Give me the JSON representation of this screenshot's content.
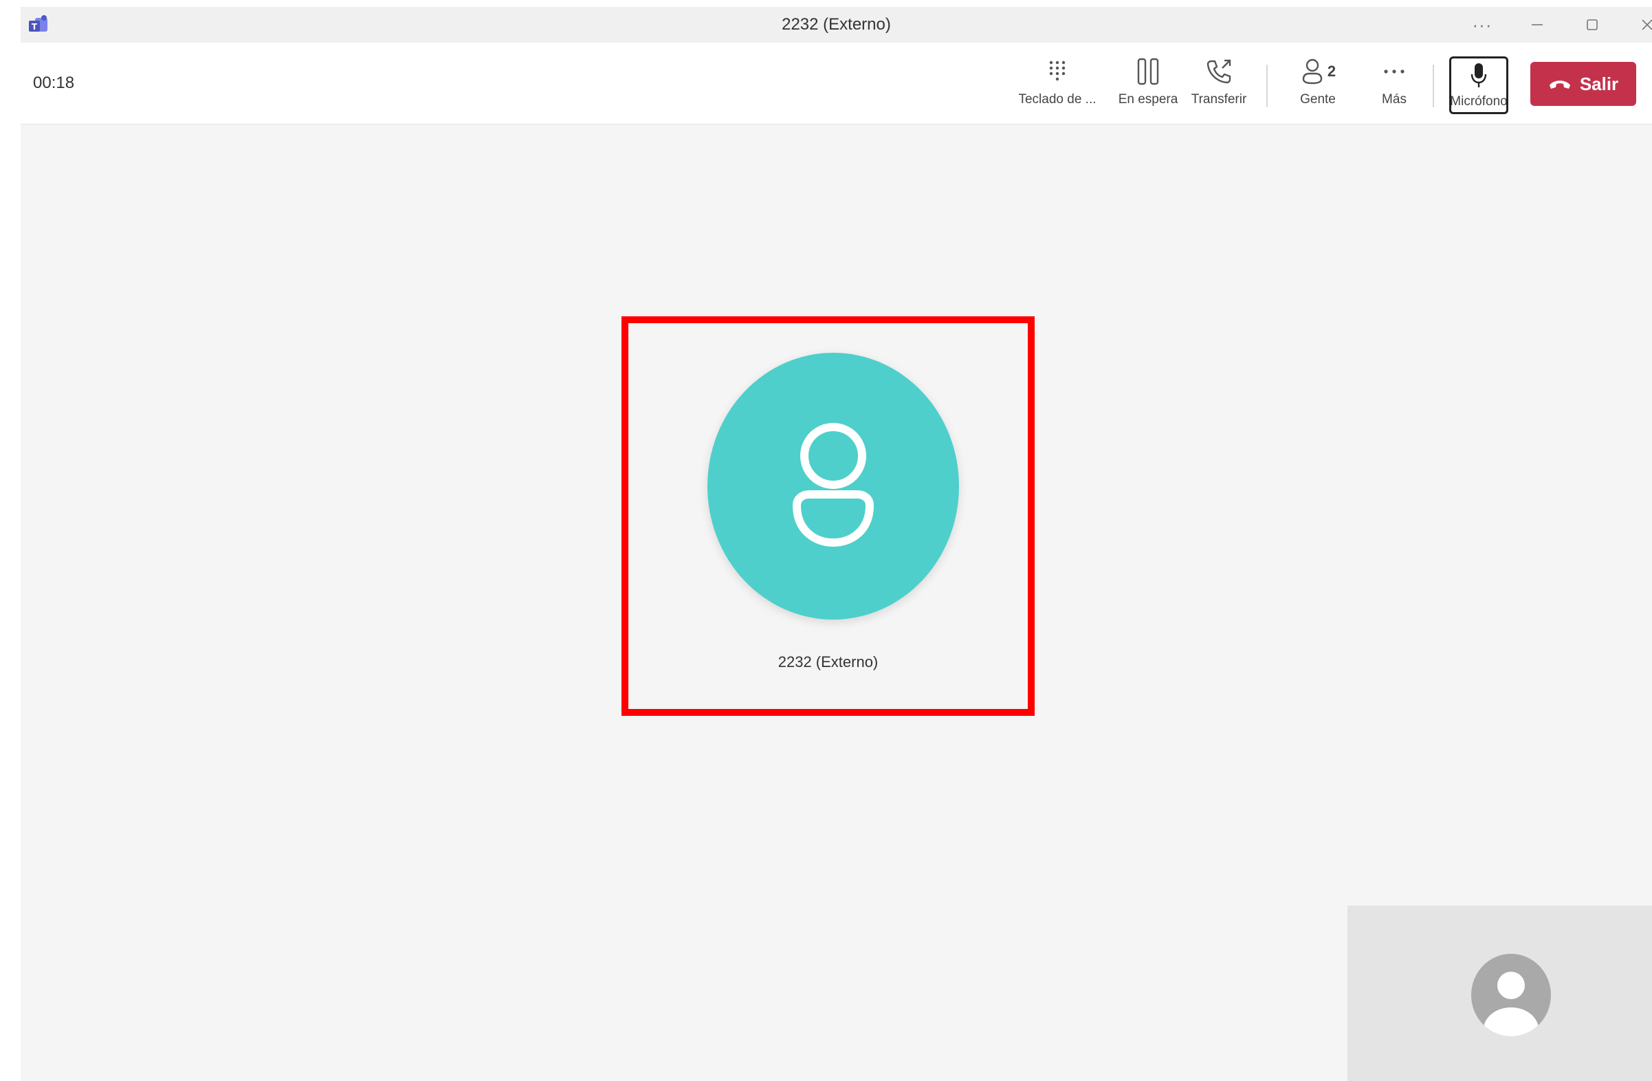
{
  "window": {
    "title": "2232 (Externo)",
    "controls": [
      "more-options",
      "minimize",
      "maximize",
      "close"
    ],
    "more_label": "···"
  },
  "toolbar": {
    "timer": "00:18",
    "keypad_label": "Teclado de ...",
    "hold_label": "En espera",
    "transfer_label": "Transferir",
    "people_label": "Gente",
    "people_count": "2",
    "more_label": "Más",
    "mic_label": "Micrófono",
    "leave_label": "Salir"
  },
  "participant": {
    "name": "2232 (Externo)",
    "avatar_color": "#4ecfcb"
  },
  "colors": {
    "leave_button": "#c4314b",
    "highlight": "#ff0000",
    "avatar": "#4ecfcb",
    "stage_background": "#f5f5f5"
  },
  "icons": {
    "app": "teams-logo-icon",
    "keypad": "dialpad-icon",
    "hold": "pause-icon",
    "transfer": "phone-transfer-icon",
    "people": "people-icon",
    "more": "more-horizontal-icon",
    "mic": "microphone-icon",
    "leave": "hang-up-icon",
    "participant": "person-icon",
    "self": "self-avatar-icon"
  }
}
